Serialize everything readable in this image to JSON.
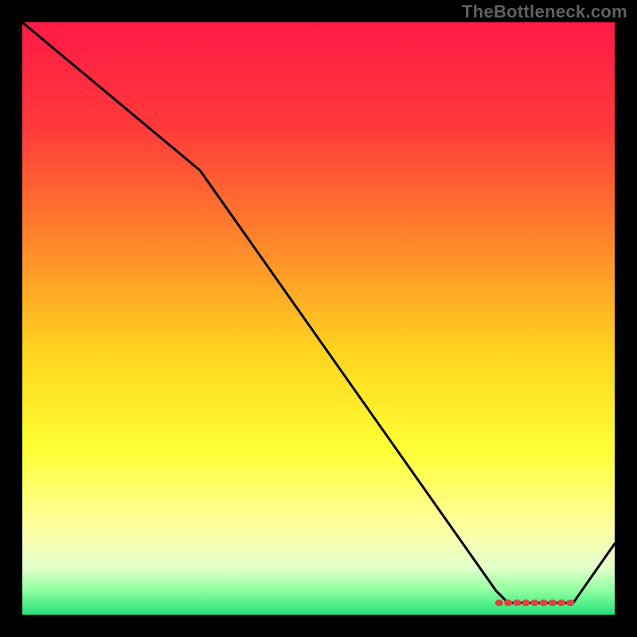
{
  "attribution": "TheBottleneck.com",
  "chart_data": {
    "type": "line",
    "title": "",
    "xlabel": "",
    "ylabel": "",
    "xlim": [
      0,
      100
    ],
    "ylim": [
      0,
      100
    ],
    "series": [
      {
        "name": "curve",
        "x": [
          0,
          30,
          80,
          82,
          90,
          93,
          100
        ],
        "y": [
          100,
          75,
          4,
          2,
          2,
          2,
          12
        ]
      }
    ],
    "markers": {
      "name": "optimal-band",
      "x": [
        80.5,
        82,
        83.5,
        85,
        86.5,
        88,
        89.5,
        91,
        92.5
      ],
      "y": [
        2,
        2,
        2,
        2,
        2,
        2,
        2,
        2,
        2
      ]
    },
    "background_gradient": {
      "stops": [
        {
          "offset": 0.0,
          "color": "#ff1a46"
        },
        {
          "offset": 0.18,
          "color": "#ff3a3a"
        },
        {
          "offset": 0.38,
          "color": "#ff8a2a"
        },
        {
          "offset": 0.55,
          "color": "#ffd21f"
        },
        {
          "offset": 0.72,
          "color": "#ffff33"
        },
        {
          "offset": 0.85,
          "color": "#ffffa0"
        },
        {
          "offset": 0.92,
          "color": "#e4ffcc"
        },
        {
          "offset": 0.96,
          "color": "#8dff9e"
        },
        {
          "offset": 1.0,
          "color": "#23e07a"
        }
      ]
    }
  }
}
